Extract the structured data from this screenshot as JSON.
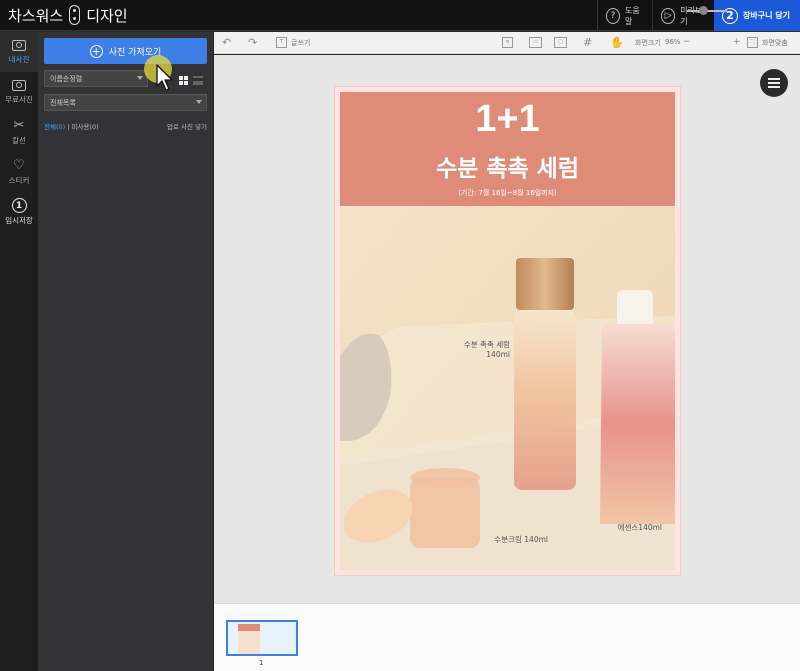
{
  "header": {
    "brand_left": "차스워스",
    "brand_right": "디자인",
    "help_label": "도움말",
    "help_icon": "?",
    "preview_label": "미리보기",
    "cart_step": "2",
    "cart_label": "장바구니 담기"
  },
  "rail": {
    "items": [
      {
        "label": "내사진",
        "icon": "photo-icon",
        "active": true
      },
      {
        "label": "무료사진",
        "icon": "free-photo-icon"
      },
      {
        "label": "칼선",
        "icon": "scissors-icon"
      },
      {
        "label": "스티커",
        "icon": "heart-icon"
      },
      {
        "label": "임시저장",
        "icon": "number-one-icon",
        "number": "1"
      }
    ]
  },
  "panel": {
    "upload_label": "사진 가져오기",
    "sort_value": "이름순정렬",
    "folder_value": "전체목록",
    "filter_all": "전체(0)",
    "filter_separator": "|",
    "filter_unused": "미사용(0)",
    "hide_used": "업로 사진 넣기"
  },
  "toolbar": {
    "text_label": "글쓰기",
    "zoom_label": "화면크기",
    "zoom_value": "96%",
    "fit_label": "화면맞춤"
  },
  "poster": {
    "headline": "1+1",
    "product_title": "수분 촉촉 세럼",
    "period": "(기간: 7월 16일~8월 16일까지)",
    "label_serum_name": "수분 촉촉 세럼",
    "label_serum_volume": "140ml",
    "label_cream": "수분크림 140ml",
    "label_essence": "에센스140ml"
  },
  "pages": {
    "current": "1"
  },
  "colors": {
    "accent": "#3d7fe6",
    "cart_blue": "#1b59d8",
    "poster_coral": "#de8c78"
  }
}
